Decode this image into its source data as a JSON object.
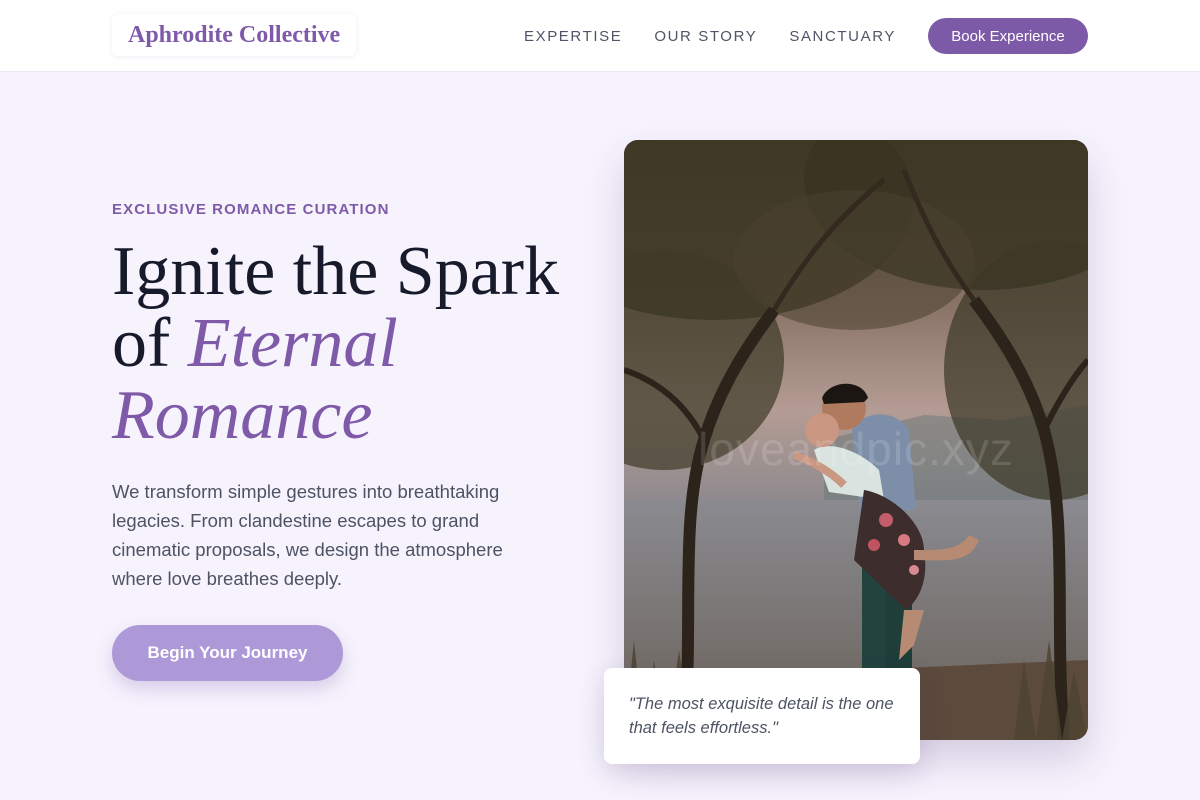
{
  "brand": {
    "name": "Aphrodite Collective"
  },
  "nav": {
    "links": [
      "EXPERTISE",
      "OUR STORY",
      "SANCTUARY"
    ],
    "cta_label": "Book Experience"
  },
  "hero": {
    "eyebrow": "EXCLUSIVE ROMANCE CURATION",
    "headline_plain": "Ignite the Spark of ",
    "headline_accent": "Eternal Romance",
    "lead": "We transform simple gestures into breathtaking legacies. From clandestine escapes to grand cinematic proposals, we design the atmosphere where love breathes deeply.",
    "cta_label": "Begin Your Journey"
  },
  "image": {
    "watermark": "loveandpic.xyz"
  },
  "quote": {
    "text": "\"The most exquisite detail is the one that feels effortless.\""
  },
  "colors": {
    "accent": "#7e5aa8",
    "button": "#7d5aa7",
    "cta_light": "#ad98d8",
    "page_bg": "#f6f3fd",
    "heading": "#161a2b",
    "body_text": "#4d5363"
  }
}
